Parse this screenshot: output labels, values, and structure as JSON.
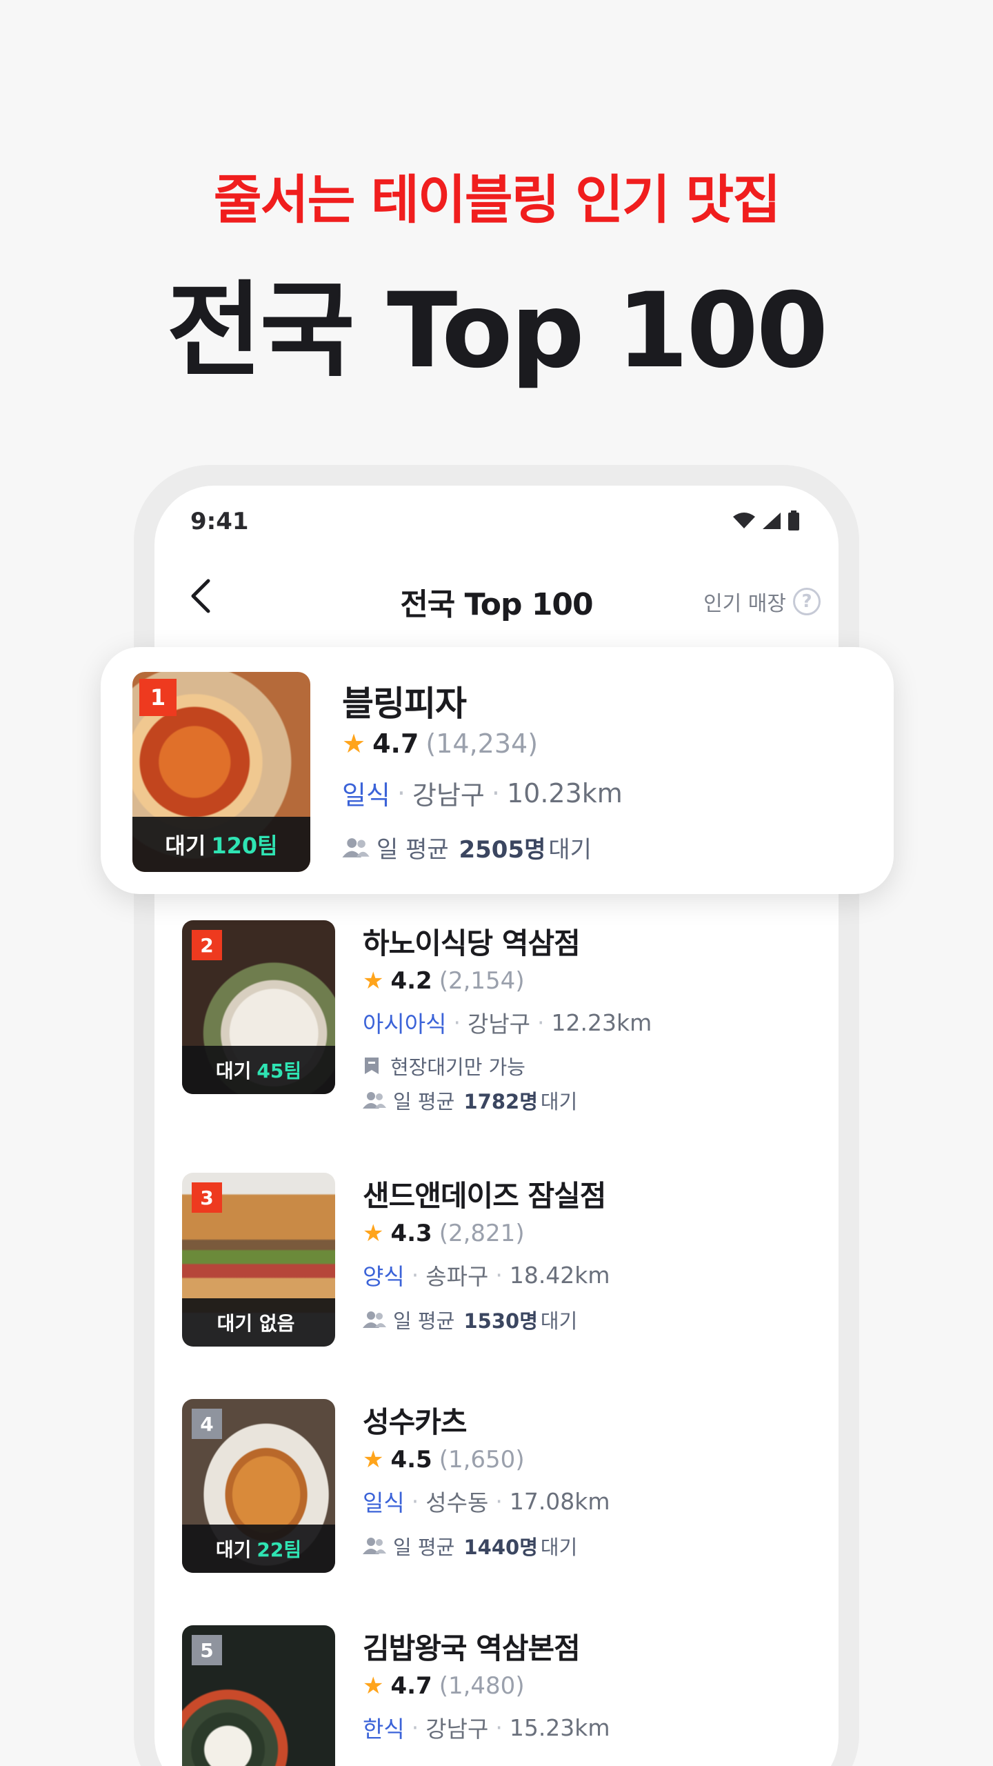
{
  "hero": {
    "subtitle": "줄서는 테이블링 인기 맛집",
    "title": "전국 Top 100"
  },
  "status_bar": {
    "time": "9:41",
    "icons": [
      "wifi-icon",
      "signal-icon",
      "battery-icon"
    ]
  },
  "nav": {
    "back_icon": "chevron-left-icon",
    "title": "전국 Top 100",
    "right_label": "인기 매장",
    "help_icon": "?"
  },
  "colors": {
    "accent_red": "#f01e1e",
    "category_blue": "#3b63d8",
    "wait_green": "#2fe4b3",
    "star_orange": "#ffa41b"
  },
  "restaurants": [
    {
      "rank": "1",
      "name": "블링피자",
      "rating": "4.7",
      "reviews": "(14,234)",
      "category": "일식",
      "area": "강남구",
      "distance": "10.23km",
      "wait_prefix": "대기",
      "wait_value": "120팀",
      "avg_prefix": "일 평균",
      "avg_value": "2505명",
      "avg_suffix": "대기"
    },
    {
      "rank": "2",
      "name": "하노이식당 역삼점",
      "rating": "4.2",
      "reviews": "(2,154)",
      "category": "아시아식",
      "area": "강남구",
      "distance": "12.23km",
      "wait_prefix": "대기",
      "wait_value": "45팀",
      "extra": "현장대기만 가능",
      "avg_prefix": "일 평균",
      "avg_value": "1782명",
      "avg_suffix": "대기"
    },
    {
      "rank": "3",
      "name": "샌드앤데이즈 잠실점",
      "rating": "4.3",
      "reviews": "(2,821)",
      "category": "양식",
      "area": "송파구",
      "distance": "18.42km",
      "wait_prefix": "대기 없음",
      "wait_value": "",
      "avg_prefix": "일 평균",
      "avg_value": "1530명",
      "avg_suffix": "대기"
    },
    {
      "rank": "4",
      "name": "성수카츠",
      "rating": "4.5",
      "reviews": "(1,650)",
      "category": "일식",
      "area": "성수동",
      "distance": "17.08km",
      "wait_prefix": "대기",
      "wait_value": "22팀",
      "avg_prefix": "일 평균",
      "avg_value": "1440명",
      "avg_suffix": "대기"
    },
    {
      "rank": "5",
      "name": "김밥왕국 역삼본점",
      "rating": "4.7",
      "reviews": "(1,480)",
      "category": "한식",
      "area": "강남구",
      "distance": "15.23km"
    }
  ]
}
